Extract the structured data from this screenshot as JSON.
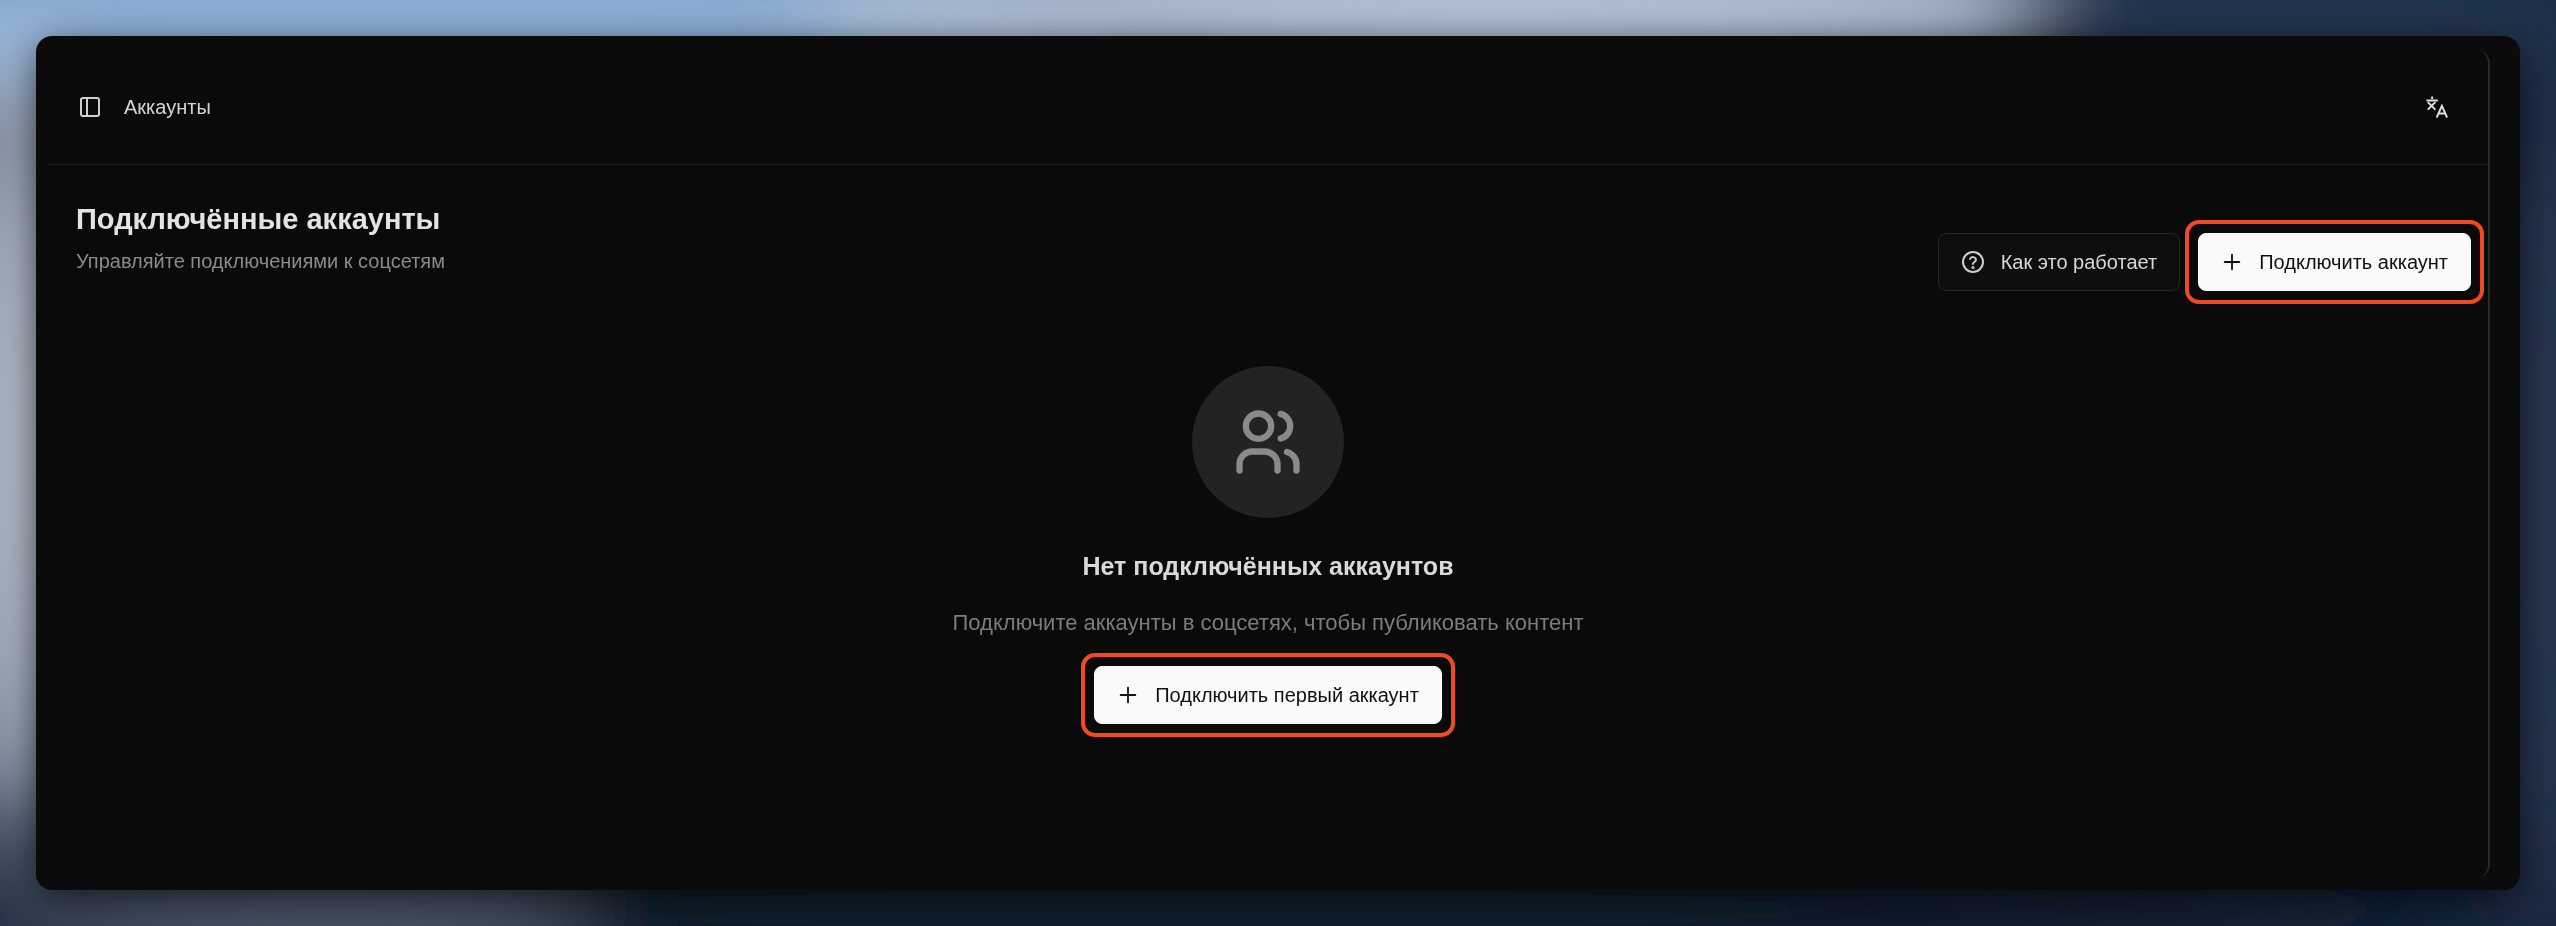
{
  "header": {
    "title": "Аккаунты"
  },
  "page": {
    "title": "Подключённые аккаунты",
    "subtitle": "Управляйте подключениями к соцсетям"
  },
  "actions": [
    {
      "kind": "secondary",
      "label": "Как это работает",
      "highlighted": false
    },
    {
      "kind": "primary",
      "label": "Подключить аккаунт",
      "highlighted": true
    }
  ],
  "empty_state": {
    "title": "Нет подключённых аккаунтов",
    "text": "Подключите аккаунты в соцсетях, чтобы публиковать контент",
    "button": {
      "label": "Подключить первый аккаунт",
      "highlighted": true
    }
  }
}
